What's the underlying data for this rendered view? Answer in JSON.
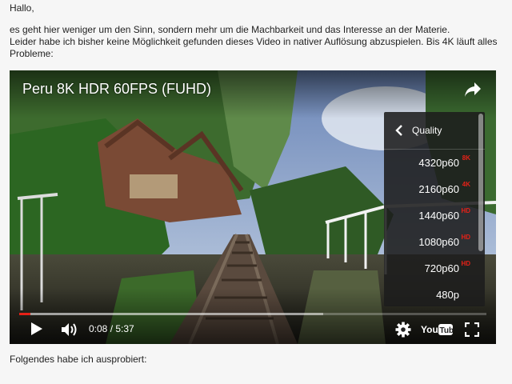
{
  "post": {
    "greeting": "Hallo,",
    "paragraph1": "es geht hier weniger um den Sinn, sondern mehr um die Machbarkeit und das Interesse an der Materie.",
    "paragraph2": "Leider habe ich bisher keine Möglichkeit gefunden dieses Video in nativer Auflösung abzuspielen. Bis 4K läuft alles",
    "paragraph3": "Probleme:",
    "footer": "Folgendes habe ich ausprobiert:"
  },
  "player": {
    "title": "Peru 8K HDR 60FPS (FUHD)",
    "time": "0:08 / 5:37",
    "progress_fraction": 0.024,
    "buffered_fraction": 0.65,
    "quality_menu": {
      "title": "Quality",
      "options": [
        {
          "label": "4320p60",
          "badge": "8K"
        },
        {
          "label": "2160p60",
          "badge": "4K"
        },
        {
          "label": "1440p60",
          "badge": "HD"
        },
        {
          "label": "1080p60",
          "badge": "HD"
        },
        {
          "label": "720p60",
          "badge": "HD"
        },
        {
          "label": "480p",
          "badge": ""
        }
      ]
    },
    "icons": {
      "share": "share-icon",
      "back": "chevron-left-icon",
      "play": "play-icon",
      "volume": "volume-icon",
      "settings": "gear-icon",
      "youtube": "youtube-logo",
      "fullscreen": "fullscreen-icon"
    },
    "colors": {
      "accent": "#e62117",
      "badge": "#e62117"
    }
  }
}
